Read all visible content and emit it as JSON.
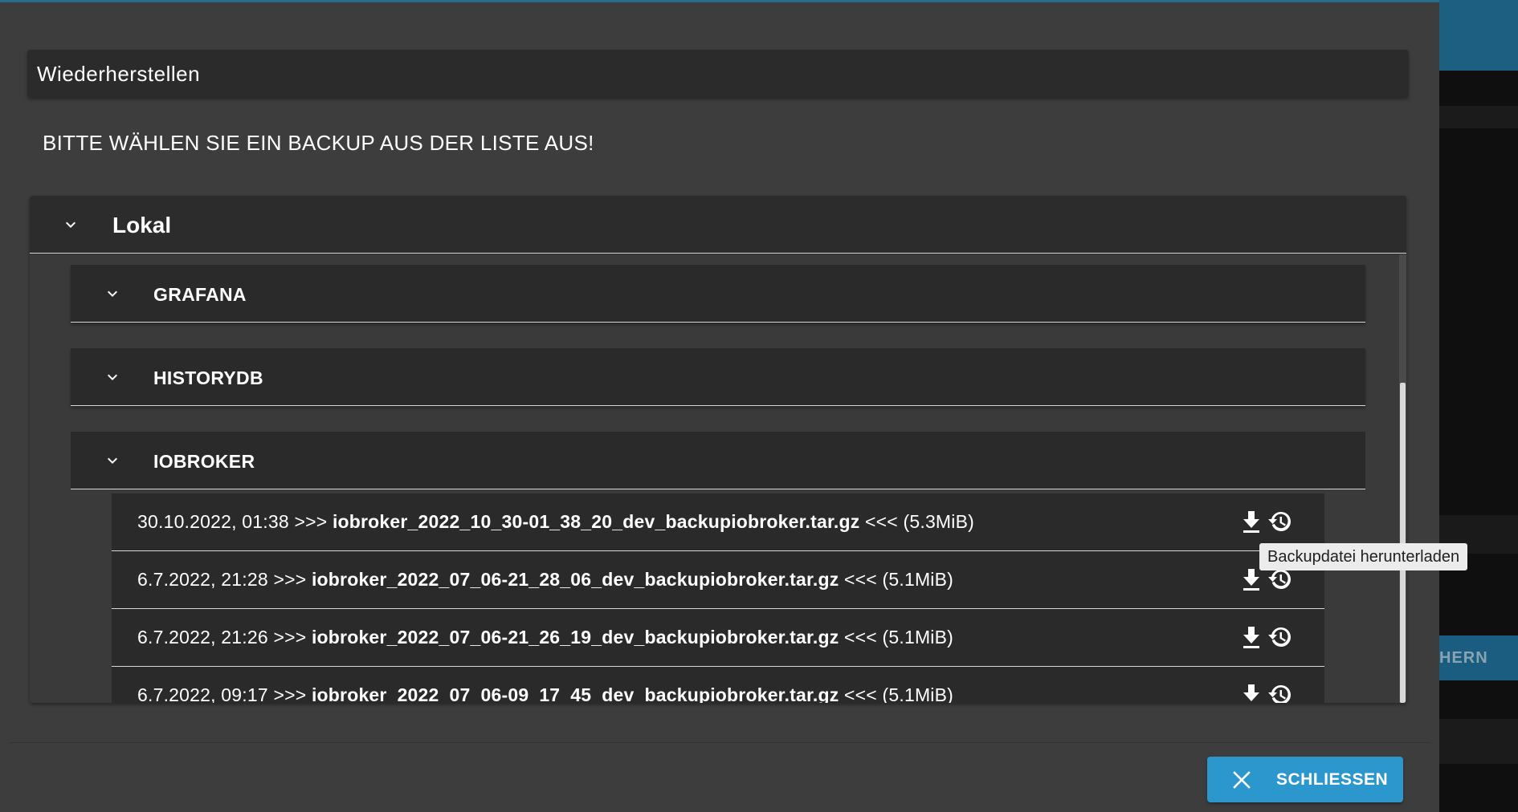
{
  "dialog": {
    "title": "Wiederherstellen",
    "prompt": "BITTE WÄHLEN SIE EIN BACKUP AUS DER LISTE AUS!",
    "close_label": "SCHLIESSEN"
  },
  "background": {
    "button_fragment": "HERN"
  },
  "panel": {
    "title": "Lokal",
    "groups": [
      {
        "label": "GRAFANA"
      },
      {
        "label": "HISTORYDB"
      },
      {
        "label": "IOBROKER"
      }
    ],
    "files": [
      {
        "date": "30.10.2022, 01:38 >>> ",
        "name": "iobroker_2022_10_30-01_38_20_dev_backupiobroker.tar.gz",
        "size": " <<< (5.3MiB)"
      },
      {
        "date": "6.7.2022, 21:28 >>> ",
        "name": "iobroker_2022_07_06-21_28_06_dev_backupiobroker.tar.gz",
        "size": " <<< (5.1MiB)"
      },
      {
        "date": "6.7.2022, 21:26 >>> ",
        "name": "iobroker_2022_07_06-21_26_19_dev_backupiobroker.tar.gz",
        "size": " <<< (5.1MiB)"
      },
      {
        "date": "6.7.2022, 09:17 >>> ",
        "name": "iobroker_2022_07_06-09_17_45_dev_backupiobroker.tar.gz",
        "size": " <<< (5.1MiB)"
      }
    ]
  },
  "tooltip": {
    "text": "Backupdatei herunterladen"
  },
  "icons": {
    "expand": "chevron-down-icon",
    "download": "download-icon",
    "restore": "restore-history-icon",
    "close": "close-icon"
  },
  "colors": {
    "accent": "#2c97cc",
    "modal_bg": "#3d3d3d",
    "header_bg": "#2b2b2b"
  }
}
